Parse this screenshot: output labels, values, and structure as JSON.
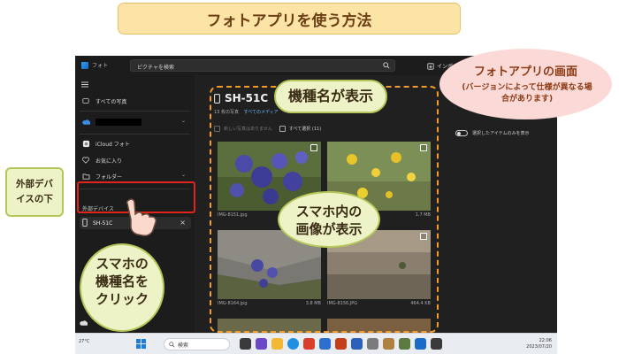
{
  "banner": {
    "title": "フォトアプリを使う方法"
  },
  "app": {
    "name": "フォト",
    "search_placeholder": "ピクチャを検索",
    "import_label": "インポ",
    "sidebar": {
      "items": [
        {
          "label": "すべての写真"
        },
        {
          "label": ""
        },
        {
          "label": "iCloud フォト"
        },
        {
          "label": "お気に入り"
        },
        {
          "label": "フォルダー"
        }
      ],
      "external_label": "外部デバイス",
      "device_label": "SH-51C"
    },
    "main": {
      "device_title": "SH-51C",
      "sub_count": "13 枚の写真",
      "sub_link": "すべてのメディア",
      "select_none": "新しい写真はありません",
      "select_all": "すべて選択 (11)",
      "toggle_label": "選択したアイテムのみを表示"
    },
    "photos": [
      {
        "name": "IMG-8151.jpg",
        "size": ""
      },
      {
        "name": "",
        "size": "1.7 MB"
      },
      {
        "name": "IMG-8164.jpg",
        "size": "3.8 MB"
      },
      {
        "name": "IMG-8156.JPG",
        "size": "464.4 KB"
      }
    ],
    "taskbar": {
      "weather": "27°C",
      "search": "検索",
      "time": "22:06",
      "date": "2023/07/20"
    }
  },
  "callouts": {
    "app_screen_title": "フォトアプリの画面",
    "app_screen_note": "(バージョンによって仕様が異なる場合があります)",
    "device_name": "機種名が表示",
    "images_shown_line1": "スマホ内の",
    "images_shown_line2": "画像が表示",
    "click_line1": "スマホの",
    "click_line2": "機種名を",
    "click_line3": "クリック",
    "external_line1": "外部デバ",
    "external_line2": "イスの下"
  },
  "colors": {
    "banner_bg": "#fce3a6",
    "dashed_outline": "#f39a2a",
    "red_outline": "#e0261c",
    "callout_green": "#eef3c7",
    "callout_peach": "#fbd9d6"
  }
}
